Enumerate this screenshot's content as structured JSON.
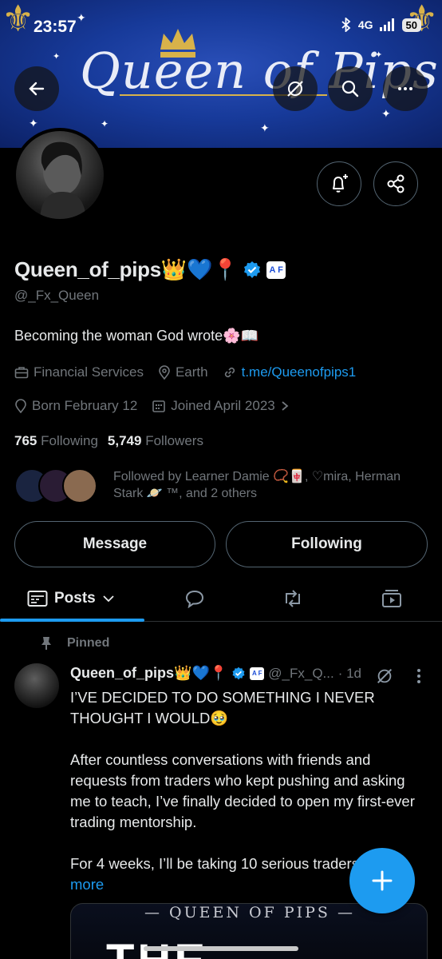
{
  "status_bar": {
    "time": "23:57",
    "network": "4G",
    "battery": "50"
  },
  "banner": {
    "title_text": "Queen of Pips"
  },
  "header_actions": {
    "back": "back-arrow-icon",
    "grok": "grok-icon",
    "search": "search-icon",
    "more": "more-icon"
  },
  "profile": {
    "display_name": "Queen_of_pips👑💙📍",
    "badge_label": "A F",
    "handle": "@_Fx_Queen",
    "bio": "Becoming the woman God wrote🌸📖",
    "category": "Financial Services",
    "location": "Earth",
    "website": "t.me/Queenofpips1",
    "born": "Born February 12",
    "joined": "Joined April 2023",
    "following_count": "765",
    "following_label": "Following",
    "followers_count": "5,749",
    "followers_label": "Followers",
    "followed_by": "Followed by Learner Damie 📿🀄, ♡mira, Herman Stark 🪐 ™, and 2 others"
  },
  "buttons": {
    "message": "Message",
    "following": "Following"
  },
  "tabs": {
    "posts_label": "Posts"
  },
  "post": {
    "pinned_label": "Pinned",
    "name": "Queen_of_pips👑💙📍",
    "badge_label": "A F",
    "handle": "@_Fx_Q...",
    "age": "· 1d",
    "body": "I’VE DECIDED TO DO SOMETHING I NEVER THOUGHT I WOULD🥹\n\nAfter countless conversations with friends and requests from traders who kept pushing and asking me to teach, I’ve finally decided to open my first-ever trading mentorship.\n\nFor 4 weeks, I’ll be taking 10 serious traders",
    "more_label": "more",
    "media_title": "— QUEEN OF PIPS —",
    "media_big": "THE"
  },
  "colors": {
    "accent": "#1d9bf0",
    "banner": "#173a9a",
    "gold": "#d8b24a"
  }
}
